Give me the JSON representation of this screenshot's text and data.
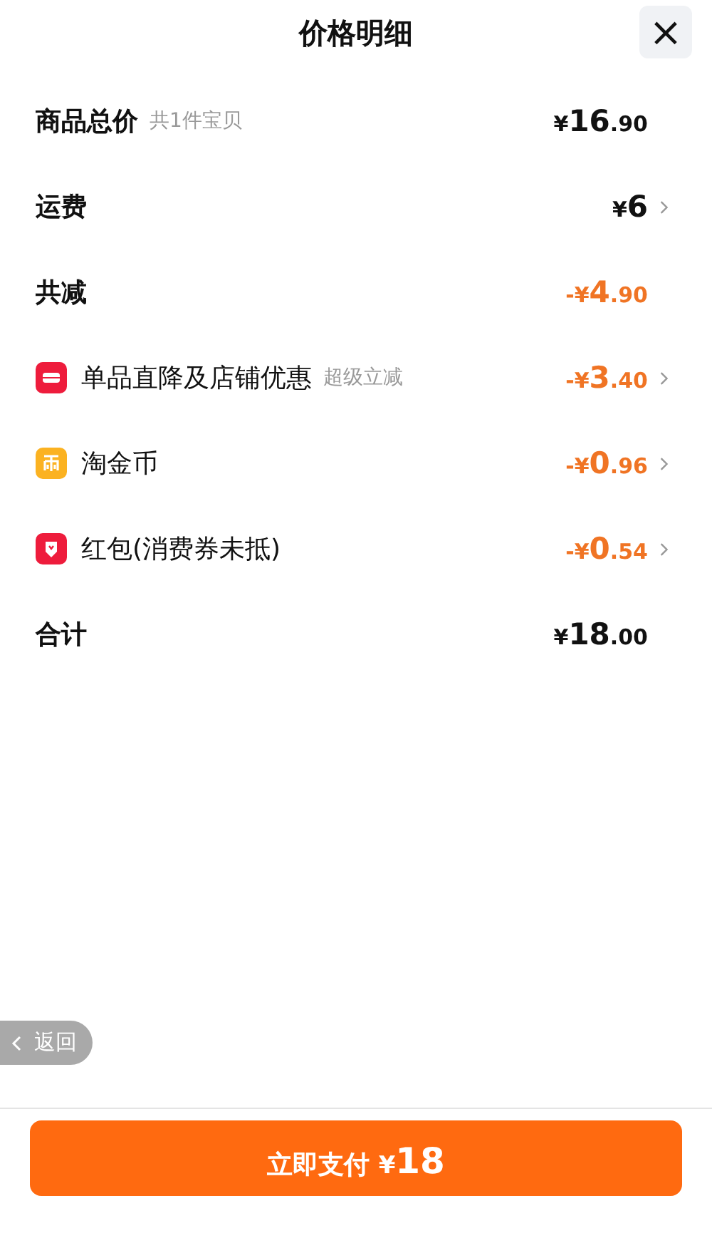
{
  "header": {
    "title": "价格明细",
    "close": "×"
  },
  "rows": [
    {
      "kind": "amount",
      "label": "商品总价",
      "note": "共1件宝贝",
      "price": "¥16.90",
      "chevron": false
    },
    {
      "kind": "amount",
      "label": "运费",
      "price": "¥6",
      "chevron": true
    },
    {
      "kind": "saving",
      "label": "共减",
      "price": "-¥4.90",
      "chevron": false
    },
    {
      "kind": "storediscount",
      "label": "单品直降及店铺优惠",
      "note": "超级立减",
      "price": "-¥3.40",
      "chevron": true
    },
    {
      "kind": "coins",
      "label": "淘金币",
      "price": "-¥0.96",
      "chevron": true
    },
    {
      "kind": "redpacket",
      "label": "红包(消费券未抵)",
      "price": "-¥0.54",
      "chevron": true
    },
    {
      "kind": "amount",
      "label": "合计",
      "price": "¥18.00",
      "chevron": false
    }
  ],
  "back": {
    "label": "返回"
  },
  "pay": {
    "label": "立即支付",
    "price": "¥18"
  }
}
